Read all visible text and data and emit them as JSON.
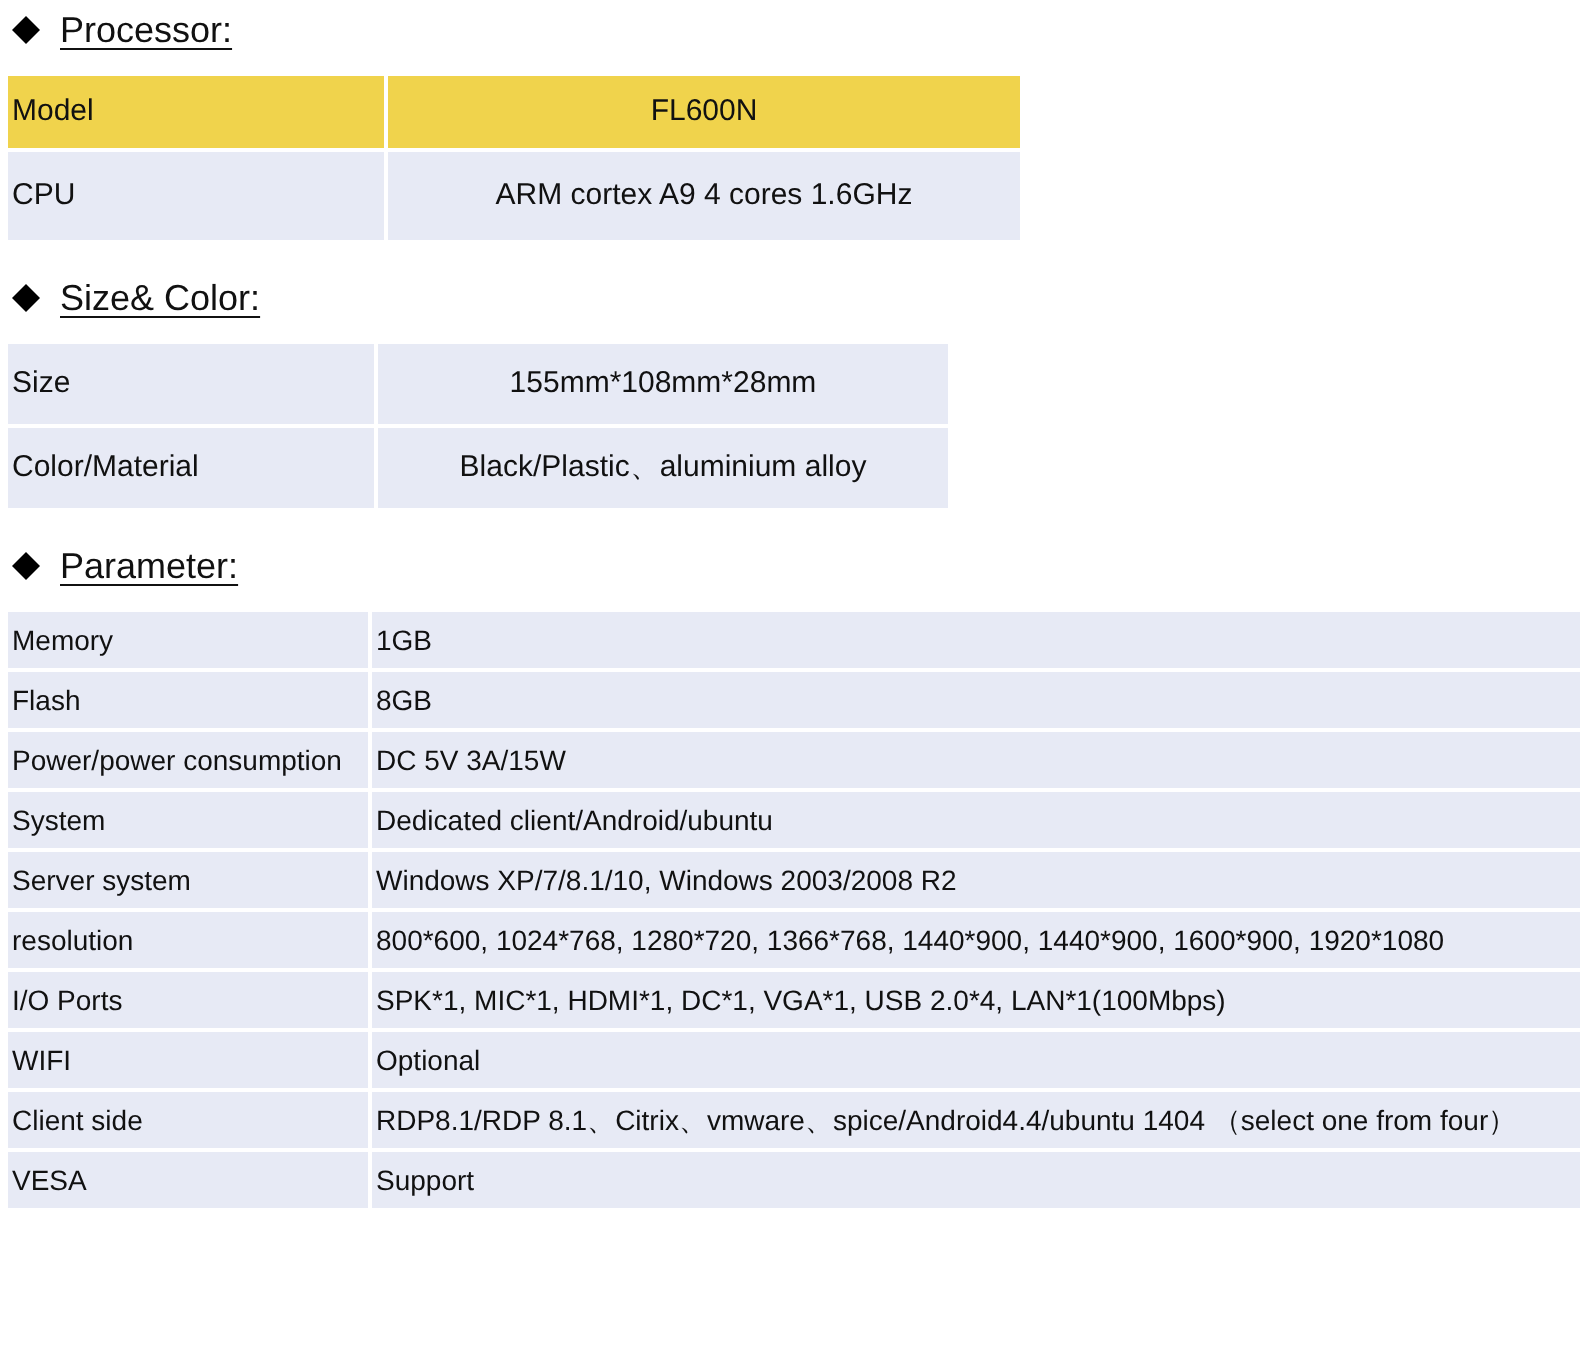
{
  "sections": [
    {
      "heading": "Processor:",
      "kind": "centered",
      "rows": [
        {
          "label": "Model",
          "value": "FL600N",
          "highlighted": true
        },
        {
          "label": "CPU",
          "value": "ARM cortex A9 4 cores 1.6GHz",
          "highlighted": false
        }
      ]
    },
    {
      "heading": "Size& Color:",
      "kind": "centered",
      "rows": [
        {
          "label": "Size",
          "value": "155mm*108mm*28mm",
          "highlighted": false
        },
        {
          "label": "Color/Material",
          "value": "Black/Plastic、aluminium alloy",
          "highlighted": false
        }
      ]
    },
    {
      "heading": "Parameter:",
      "kind": "plain",
      "rows": [
        {
          "label": "Memory",
          "value": "1GB",
          "highlighted": false
        },
        {
          "label": "Flash",
          "value": "8GB",
          "highlighted": false
        },
        {
          "label": "Power/power consumption",
          "value": "DC 5V 3A/15W",
          "highlighted": false
        },
        {
          "label": "System",
          "value": "Dedicated client/Android/ubuntu",
          "highlighted": false
        },
        {
          "label": "Server system",
          "value": "Windows XP/7/8.1/10,  Windows 2003/2008 R2",
          "highlighted": false
        },
        {
          "label": "resolution",
          "value": "800*600,  1024*768, 1280*720, 1366*768, 1440*900,  1440*900,   1600*900, 1920*1080",
          "highlighted": false
        },
        {
          "label": "I/O Ports",
          "value": "SPK*1,  MIC*1,  HDMI*1, DC*1, VGA*1,  USB 2.0*4,  LAN*1(100Mbps)",
          "highlighted": false
        },
        {
          "label": "WIFI",
          "value": "Optional",
          "highlighted": false
        },
        {
          "label": "Client side",
          "value": "RDP8.1/RDP 8.1、Citrix、vmware、spice/Android4.4/ubuntu 1404 （select one from four）",
          "highlighted": false
        },
        {
          "label": "VESA",
          "value": "Support",
          "highlighted": false
        }
      ]
    }
  ]
}
